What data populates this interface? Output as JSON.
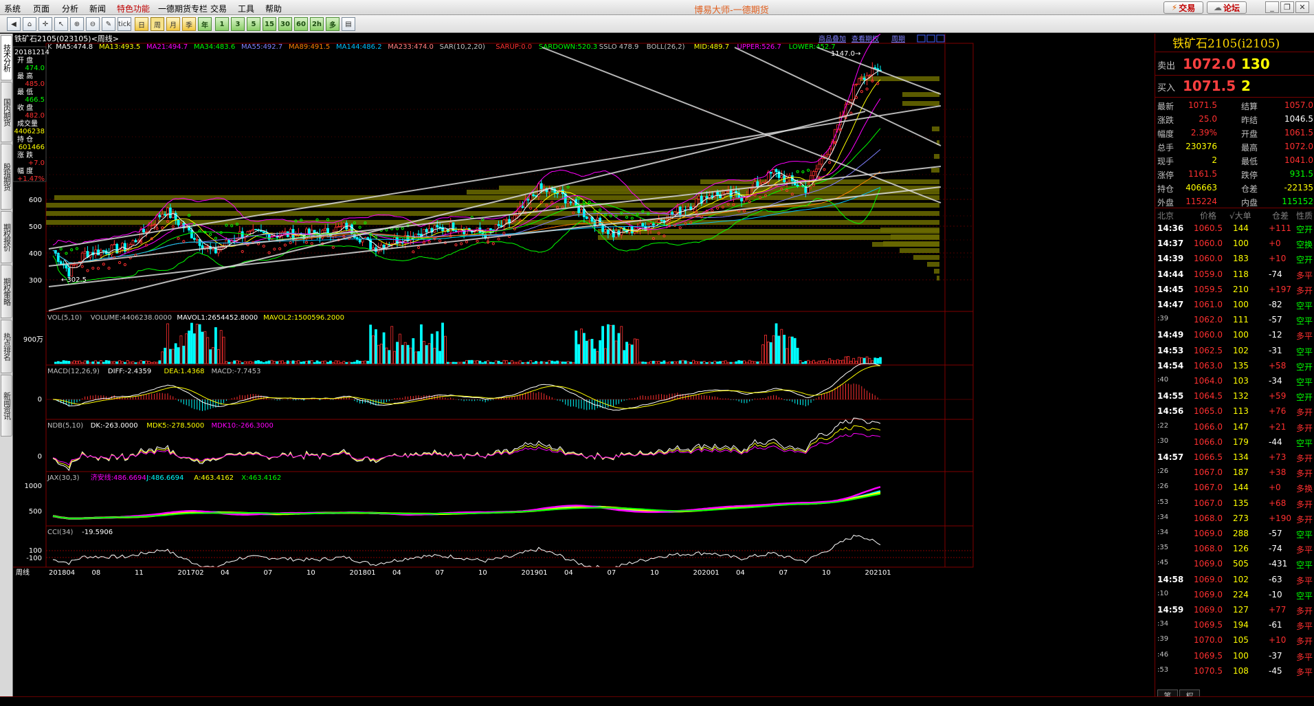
{
  "menu": [
    {
      "label": "系统",
      "red": false
    },
    {
      "label": "页面",
      "red": false
    },
    {
      "label": "分析",
      "red": false
    },
    {
      "label": "新闻",
      "red": false
    },
    {
      "label": "特色功能",
      "red": true
    },
    {
      "label": "一德期货专栏",
      "red": false
    },
    {
      "label": "交易",
      "red": false
    },
    {
      "label": "工具",
      "red": false
    },
    {
      "label": "帮助",
      "red": false
    }
  ],
  "app_title": "博易大师-一德期货",
  "header_buttons": {
    "trade": "交易",
    "forum": "论坛"
  },
  "toolbar_icons": [
    {
      "name": "back-icon",
      "glyph": "◀"
    },
    {
      "name": "home-icon",
      "glyph": "⌂"
    },
    {
      "name": "cross-icon",
      "glyph": "✛"
    },
    {
      "name": "pointer-icon",
      "glyph": "↖"
    },
    {
      "name": "zoom-in-icon",
      "glyph": "⊕"
    },
    {
      "name": "zoom-out-icon",
      "glyph": "⊖"
    },
    {
      "name": "draw-pen-icon",
      "glyph": "✎"
    },
    {
      "name": "tick-chart-icon",
      "glyph": "tick"
    },
    {
      "name": "period-day-icon",
      "glyph": "日"
    },
    {
      "name": "period-week-icon",
      "glyph": "周"
    },
    {
      "name": "period-month-icon",
      "glyph": "月"
    },
    {
      "name": "period-season-icon",
      "glyph": "季"
    },
    {
      "name": "period-year-icon",
      "glyph": "年"
    },
    {
      "name": "min1-icon",
      "glyph": "1"
    },
    {
      "name": "min3-icon",
      "glyph": "3"
    },
    {
      "name": "min5-icon",
      "glyph": "5"
    },
    {
      "name": "min15-icon",
      "glyph": "15"
    },
    {
      "name": "min30-icon",
      "glyph": "30"
    },
    {
      "name": "min60-icon",
      "glyph": "60"
    },
    {
      "name": "min120-icon",
      "glyph": "2h"
    },
    {
      "name": "multi-period-icon",
      "glyph": "多"
    },
    {
      "name": "note-icon",
      "glyph": "▤"
    }
  ],
  "left_tabs": [
    "技术分析",
    "国内期货",
    "股指期货",
    "期权报价",
    "期权策略",
    "热点排名",
    "新闻资讯"
  ],
  "chart_header": {
    "symbol": "铁矿石2105(023105)<周线>",
    "links": [
      "商品叠加",
      "查看期权",
      "周期"
    ]
  },
  "info_box": {
    "date": "20181214",
    "rows": [
      {
        "label": "开 盘",
        "value": "474.0",
        "color": "#00ff00"
      },
      {
        "label": "最 高",
        "value": "485.0",
        "color": "#ff3030"
      },
      {
        "label": "最 低",
        "value": "466.5",
        "color": "#00ff00"
      },
      {
        "label": "收 盘",
        "value": "482.0",
        "color": "#ff3030"
      },
      {
        "label": "成交量",
        "value": "4406238",
        "color": "#ffff00"
      },
      {
        "label": "持 仓",
        "value": "601466",
        "color": "#ffff00"
      },
      {
        "label": "涨 跌",
        "value": "+7.0",
        "color": "#ff3030"
      },
      {
        "label": "幅 度",
        "value": "+1.47%",
        "color": "#ff3030"
      }
    ]
  },
  "indicator_lines": {
    "main": [
      {
        "text": "K",
        "color": "#c0c0c0"
      },
      {
        "text": "MA5:474.8",
        "color": "#ffffff"
      },
      {
        "text": "MA13:493.5",
        "color": "#ffff00"
      },
      {
        "text": "MA21:494.7",
        "color": "#ff00ff"
      },
      {
        "text": "MA34:483.6",
        "color": "#00ff00"
      },
      {
        "text": "MA55:492.7",
        "color": "#8080ff"
      },
      {
        "text": "MA89:491.5",
        "color": "#ff8000"
      },
      {
        "text": "MA144:486.2",
        "color": "#00c0ff"
      },
      {
        "text": "MA233:474.0",
        "color": "#ff8080"
      },
      {
        "text": "SAR(10,2,20)",
        "color": "#c0c0c0"
      },
      {
        "text": "SARUP:0.0",
        "color": "#ff3030"
      },
      {
        "text": "SARDOWN:520.3",
        "color": "#00ff00"
      },
      {
        "text": "SSLO 478.9",
        "color": "#c0c0c0"
      },
      {
        "text": "BOLL(26,2)",
        "color": "#c0c0c0"
      },
      {
        "text": "MID:489.7",
        "color": "#ffff00"
      },
      {
        "text": "UPPER:526.7",
        "color": "#ff00ff"
      },
      {
        "text": "LOWER:452.7",
        "color": "#00ff00"
      }
    ],
    "vol": [
      {
        "text": "VOL(5,10)",
        "color": "#c0c0c0"
      },
      {
        "text": "VOLUME:4406238.0000",
        "color": "#c0c0c0"
      },
      {
        "text": "MAVOL1:2654452.8000",
        "color": "#ffffff"
      },
      {
        "text": "MAVOL2:1500596.2000",
        "color": "#ffff00"
      }
    ],
    "macd": [
      {
        "text": "MACD(12,26,9)",
        "color": "#c0c0c0"
      },
      {
        "text": "DIFF:-2.4359",
        "color": "#ffffff"
      },
      {
        "text": "DEA:1.4368",
        "color": "#ffff00"
      },
      {
        "text": "MACD:-7.7453",
        "color": "#c0c0c0"
      }
    ],
    "ndb": [
      {
        "text": "NDB(5,10)",
        "color": "#c0c0c0"
      },
      {
        "text": "DK:-263.0000",
        "color": "#ffffff"
      },
      {
        "text": "MDK5:-278.5000",
        "color": "#ffff00"
      },
      {
        "text": "MDK10:-266.3000",
        "color": "#ff00ff"
      }
    ],
    "jax": [
      {
        "text": "JAX(30,3)",
        "color": "#c0c0c0"
      },
      {
        "text": "济安线:486.6694",
        "color": "#ff00ff"
      },
      {
        "text": "J:486.6694",
        "color": "#00ffff"
      },
      {
        "text": "A:463.4162",
        "color": "#ffff00"
      },
      {
        "text": "X:463.4162",
        "color": "#00ff00"
      }
    ],
    "cci": [
      {
        "text": "CCI(34)",
        "color": "#c0c0c0"
      },
      {
        "text": "-19.5906",
        "color": "#ffffff"
      }
    ]
  },
  "axis_labels": {
    "price": [
      "600",
      "500",
      "400",
      "300"
    ],
    "vol": [
      "900万"
    ],
    "macd": [
      "0"
    ],
    "ndb": [
      "0"
    ],
    "jax": [
      "1000",
      "500"
    ],
    "cci": [
      "100",
      "-100"
    ]
  },
  "price_annotations": {
    "low": "←302.5",
    "high": "1147.0→"
  },
  "x_axis": {
    "label": "周线",
    "ticks": [
      "201804",
      "08",
      "11",
      "201702",
      "04",
      "07",
      "10",
      "201801",
      "04",
      "07",
      "10",
      "201901",
      "04",
      "07",
      "10",
      "202001",
      "04",
      "07",
      "10",
      "202101"
    ]
  },
  "right_panel": {
    "title": "铁矿石2105(i2105)",
    "sell": {
      "label": "卖出",
      "price": "1072.0",
      "vol": "130"
    },
    "buy": {
      "label": "买入",
      "price": "1071.5",
      "vol": "2"
    },
    "quote_rows": [
      {
        "l1": "最新",
        "v1": "1071.5",
        "c1": "#ff3030",
        "l2": "结算",
        "v2": "1057.0",
        "c2": "#ff3030"
      },
      {
        "l1": "涨跌",
        "v1": "25.0",
        "c1": "#ff3030",
        "l2": "昨结",
        "v2": "1046.5",
        "c2": "#ffffff"
      },
      {
        "l1": "幅度",
        "v1": "2.39%",
        "c1": "#ff3030",
        "l2": "开盘",
        "v2": "1061.5",
        "c2": "#ff3030"
      },
      {
        "l1": "总手",
        "v1": "230376",
        "c1": "#ffff00",
        "l2": "最高",
        "v2": "1072.0",
        "c2": "#ff3030"
      },
      {
        "l1": "现手",
        "v1": "2",
        "c1": "#ffff00",
        "l2": "最低",
        "v2": "1041.0",
        "c2": "#ff3030"
      },
      {
        "l1": "涨停",
        "v1": "1161.5",
        "c1": "#ff3030",
        "l2": "跌停",
        "v2": "931.5",
        "c2": "#00ff00"
      },
      {
        "l1": "持仓",
        "v1": "406663",
        "c1": "#ffff00",
        "l2": "仓差",
        "v2": "-22135",
        "c2": "#ffff00"
      },
      {
        "l1": "外盘",
        "v1": "115224",
        "c1": "#ff3030",
        "l2": "内盘",
        "v2": "115152",
        "c2": "#00ff00"
      }
    ],
    "trades_header": {
      "time": "北京",
      "price": "价格",
      "vol": "√大单",
      "oi": "仓差",
      "nature": "性质"
    },
    "trades": [
      {
        "time": "14:36",
        "price": "1060.5",
        "vol": "144",
        "oi": "+111",
        "nature": "空开",
        "big": true
      },
      {
        "time": "14:37",
        "price": "1060.0",
        "vol": "100",
        "oi": "+0",
        "nature": "空换",
        "big": true
      },
      {
        "time": "14:39",
        "price": "1060.0",
        "vol": "183",
        "oi": "+10",
        "nature": "空开",
        "big": true
      },
      {
        "time": "14:44",
        "price": "1059.0",
        "vol": "118",
        "oi": "-74",
        "nature": "多平",
        "big": true
      },
      {
        "time": "14:45",
        "price": "1059.5",
        "vol": "210",
        "oi": "+197",
        "nature": "多开",
        "big": true
      },
      {
        "time": "14:47",
        "price": "1061.0",
        "vol": "100",
        "oi": "-82",
        "nature": "空平",
        "big": true
      },
      {
        "time": ":39",
        "price": "1062.0",
        "vol": "111",
        "oi": "-57",
        "nature": "空平",
        "big": false
      },
      {
        "time": "14:49",
        "price": "1060.0",
        "vol": "100",
        "oi": "-12",
        "nature": "多平",
        "big": true
      },
      {
        "time": "14:53",
        "price": "1062.5",
        "vol": "102",
        "oi": "-31",
        "nature": "空平",
        "big": true
      },
      {
        "time": "14:54",
        "price": "1063.0",
        "vol": "135",
        "oi": "+58",
        "nature": "空开",
        "big": true
      },
      {
        "time": ":40",
        "price": "1064.0",
        "vol": "103",
        "oi": "-34",
        "nature": "空平",
        "big": false
      },
      {
        "time": "14:55",
        "price": "1064.5",
        "vol": "132",
        "oi": "+59",
        "nature": "空开",
        "big": true
      },
      {
        "time": "14:56",
        "price": "1065.0",
        "vol": "113",
        "oi": "+76",
        "nature": "多开",
        "big": true
      },
      {
        "time": ":22",
        "price": "1066.0",
        "vol": "147",
        "oi": "+21",
        "nature": "多开",
        "big": false
      },
      {
        "time": ":30",
        "price": "1066.0",
        "vol": "179",
        "oi": "-44",
        "nature": "空平",
        "big": false
      },
      {
        "time": "14:57",
        "price": "1066.5",
        "vol": "134",
        "oi": "+73",
        "nature": "多开",
        "big": true
      },
      {
        "time": ":26",
        "price": "1067.0",
        "vol": "187",
        "oi": "+38",
        "nature": "多开",
        "big": false
      },
      {
        "time": ":26",
        "price": "1067.0",
        "vol": "144",
        "oi": "+0",
        "nature": "多换",
        "big": false
      },
      {
        "time": ":53",
        "price": "1067.0",
        "vol": "135",
        "oi": "+68",
        "nature": "多开",
        "big": false
      },
      {
        "time": ":34",
        "price": "1068.0",
        "vol": "273",
        "oi": "+190",
        "nature": "多开",
        "big": false
      },
      {
        "time": ":34",
        "price": "1069.0",
        "vol": "288",
        "oi": "-57",
        "nature": "空平",
        "big": false
      },
      {
        "time": ":35",
        "price": "1068.0",
        "vol": "126",
        "oi": "-74",
        "nature": "多平",
        "big": false
      },
      {
        "time": ":45",
        "price": "1069.0",
        "vol": "505",
        "oi": "-431",
        "nature": "空平",
        "big": false
      },
      {
        "time": "14:58",
        "price": "1069.0",
        "vol": "102",
        "oi": "-63",
        "nature": "多平",
        "big": true
      },
      {
        "time": ":10",
        "price": "1069.0",
        "vol": "224",
        "oi": "-10",
        "nature": "空平",
        "big": false
      },
      {
        "time": "14:59",
        "price": "1069.0",
        "vol": "127",
        "oi": "+77",
        "nature": "多开",
        "big": true
      },
      {
        "time": ":34",
        "price": "1069.5",
        "vol": "194",
        "oi": "-61",
        "nature": "多平",
        "big": false
      },
      {
        "time": ":39",
        "price": "1070.0",
        "vol": "105",
        "oi": "+10",
        "nature": "多开",
        "big": false
      },
      {
        "time": ":46",
        "price": "1069.5",
        "vol": "100",
        "oi": "-37",
        "nature": "多平",
        "big": false
      },
      {
        "time": ":53",
        "price": "1070.5",
        "vol": "108",
        "oi": "-45",
        "nature": "多平",
        "big": false
      }
    ],
    "bottom_tabs": [
      "笔",
      "权"
    ]
  },
  "colors": {
    "up": "#ff3030",
    "down": "#00ffff",
    "grid": "#800000",
    "volume_profile": "#6b6b00"
  }
}
